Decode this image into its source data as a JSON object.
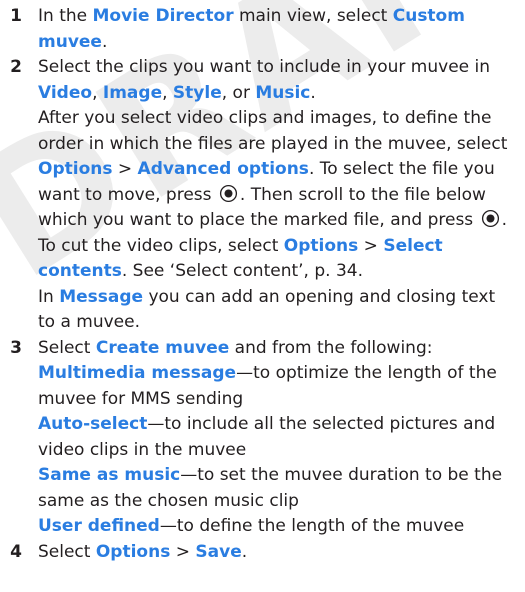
{
  "watermark": "DRAFT",
  "colors": {
    "keyword": "#2a7de1",
    "text": "#231f20",
    "watermark": "#ececec"
  },
  "icons": {
    "select_key": "scroll-key-press-icon"
  },
  "steps": [
    {
      "number": "1",
      "lines": [
        [
          {
            "t": "In the "
          },
          {
            "t": "Movie Director",
            "k": 1
          },
          {
            "t": " main view, select "
          },
          {
            "t": "Custom",
            "k": 1
          }
        ],
        [
          {
            "t": "muvee",
            "k": 1
          },
          {
            "t": "."
          }
        ]
      ]
    },
    {
      "number": "2",
      "lines": [
        [
          {
            "t": "Select the clips you want to include in your muvee in"
          }
        ],
        [
          {
            "t": "Video",
            "k": 1
          },
          {
            "t": ", "
          },
          {
            "t": "Image",
            "k": 1
          },
          {
            "t": ", "
          },
          {
            "t": "Style",
            "k": 1
          },
          {
            "t": ", or "
          },
          {
            "t": "Music",
            "k": 1
          },
          {
            "t": "."
          }
        ],
        [
          {
            "t": "After you select video clips and images, to define the"
          }
        ],
        [
          {
            "t": "order in which the files are played in the muvee, select"
          }
        ],
        [
          {
            "t": "Options",
            "k": 1
          },
          {
            "t": " > "
          },
          {
            "t": "Advanced options",
            "k": 1
          },
          {
            "t": ". To select the file you"
          }
        ],
        [
          {
            "t": "want to move, press "
          },
          {
            "icon": 1
          },
          {
            "t": ". Then scroll to the file below"
          }
        ],
        [
          {
            "t": "which you want to place the marked file, and press "
          },
          {
            "icon": 1
          },
          {
            "t": "."
          }
        ],
        [
          {
            "t": "To cut the video clips, select "
          },
          {
            "t": "Options",
            "k": 1
          },
          {
            "t": " > "
          },
          {
            "t": "Select",
            "k": 1
          }
        ],
        [
          {
            "t": "contents",
            "k": 1
          },
          {
            "t": ". See ‘Select content’, p. 34."
          }
        ],
        [
          {
            "t": "In "
          },
          {
            "t": "Message",
            "k": 1
          },
          {
            "t": " you can add an opening and closing text"
          }
        ],
        [
          {
            "t": "to a muvee."
          }
        ]
      ]
    },
    {
      "number": "3",
      "lines": [
        [
          {
            "t": "Select "
          },
          {
            "t": "Create muvee",
            "k": 1
          },
          {
            "t": " and from the following:"
          }
        ],
        [
          {
            "t": "Multimedia message",
            "k": 1
          },
          {
            "t": "—to optimize the length of the"
          }
        ],
        [
          {
            "t": "muvee for MMS sending"
          }
        ],
        [
          {
            "t": "Auto-select",
            "k": 1
          },
          {
            "t": "—to include all the selected pictures and"
          }
        ],
        [
          {
            "t": "video clips in the muvee"
          }
        ],
        [
          {
            "t": "Same as music",
            "k": 1
          },
          {
            "t": "—to set the muvee duration to be the"
          }
        ],
        [
          {
            "t": "same as the chosen music clip"
          }
        ],
        [
          {
            "t": "User defined",
            "k": 1
          },
          {
            "t": "—to define the length of the muvee"
          }
        ]
      ]
    },
    {
      "number": "4",
      "lines": [
        [
          {
            "t": "Select "
          },
          {
            "t": "Options",
            "k": 1
          },
          {
            "t": " > "
          },
          {
            "t": "Save",
            "k": 1
          },
          {
            "t": "."
          }
        ]
      ]
    }
  ]
}
